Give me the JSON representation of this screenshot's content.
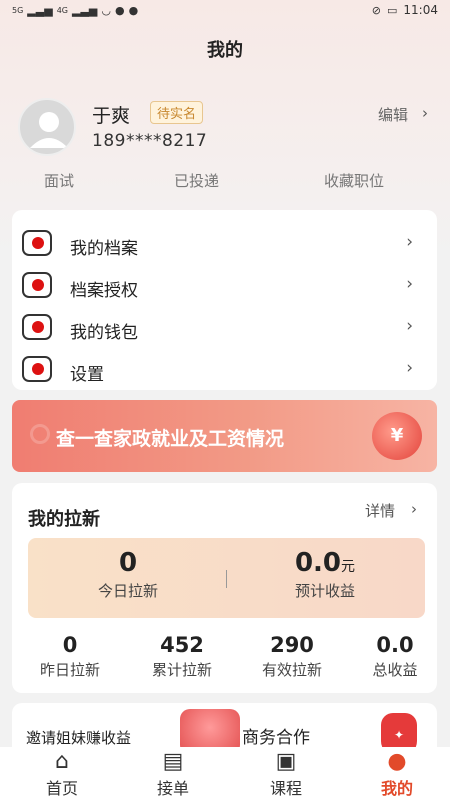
{
  "status_bar": {
    "signal_1": "5G",
    "signal_2": "4G",
    "battery": "▭",
    "time": "11:04"
  },
  "header": {
    "title": "我的"
  },
  "profile": {
    "name": "于爽",
    "badge": "待实名",
    "phone": "189****8217",
    "edit_label": "编辑",
    "chevron": "›"
  },
  "quick_tabs": {
    "interview": "面试",
    "delivered": "已投递",
    "favorites": "收藏职位"
  },
  "menu": {
    "items": [
      {
        "label": "我的档案",
        "icon": "document-icon"
      },
      {
        "label": "档案授权",
        "icon": "authorization-icon"
      },
      {
        "label": "我的钱包",
        "icon": "wallet-icon"
      },
      {
        "label": "设置",
        "icon": "settings-icon"
      }
    ],
    "chevron": "›"
  },
  "banner": {
    "text": "查一查家政就业及工资情况",
    "coin_symbol": "¥"
  },
  "invite": {
    "title": "我的拉新",
    "detail_label": "详情",
    "today_value": "0",
    "today_label": "今日拉新",
    "expected_value": "0.0",
    "expected_unit": "元",
    "expected_label": "预计收益",
    "mini": [
      {
        "value": "0",
        "label": "昨日拉新"
      },
      {
        "value": "452",
        "label": "累计拉新"
      },
      {
        "value": "290",
        "label": "有效拉新"
      },
      {
        "value": "0.0",
        "label": "总收益"
      }
    ]
  },
  "promo": {
    "left_text": "邀请姐妹赚收益",
    "right_text": "商务合作"
  },
  "bottom_nav": {
    "items": [
      {
        "label": "首页",
        "icon": "home-icon"
      },
      {
        "label": "接单",
        "icon": "orders-icon"
      },
      {
        "label": "课程",
        "icon": "course-icon"
      },
      {
        "label": "我的",
        "icon": "profile-icon"
      }
    ],
    "active_color": "#e24a2a"
  }
}
